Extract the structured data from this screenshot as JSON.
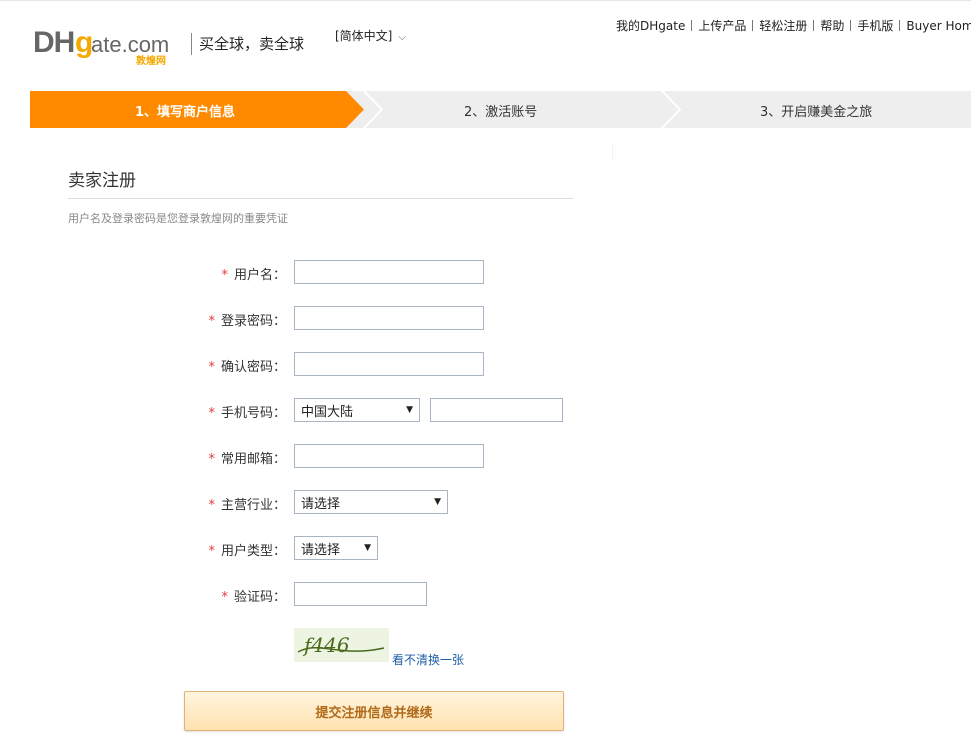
{
  "header": {
    "logo": {
      "brand": "DHgate.com",
      "sub": "敦煌网",
      "logo_colors": {
        "dh": "#666666",
        "gate": "#f5a800",
        "sub": "#f5a800"
      }
    },
    "slogan": "买全球，卖全球",
    "language": "[简体中文]",
    "links": [
      "我的DHgate",
      "上传产品",
      "轻松注册",
      "帮助",
      "手机版",
      "Buyer Home"
    ]
  },
  "steps": [
    {
      "label": "1、填写商户信息",
      "active": true
    },
    {
      "label": "2、激活账号",
      "active": false
    },
    {
      "label": "3、开启赚美金之旅",
      "active": false
    }
  ],
  "form": {
    "title": "卖家注册",
    "note": "用户名及登录密码是您登录敦煌网的重要凭证",
    "required_mark": "*",
    "fields": {
      "username": {
        "label": "用户名：",
        "value": ""
      },
      "password": {
        "label": "登录密码：",
        "value": ""
      },
      "confirm_password": {
        "label": "确认密码：",
        "value": ""
      },
      "phone": {
        "label": "手机号码：",
        "region": "中国大陆",
        "value": ""
      },
      "email": {
        "label": "常用邮箱：",
        "value": ""
      },
      "industry": {
        "label": "主营行业：",
        "selected": "请选择"
      },
      "user_type": {
        "label": "用户类型：",
        "selected": "请选择"
      },
      "captcha": {
        "label": "验证码：",
        "value": "",
        "image_text": "f446",
        "refresh_label": "看不清换一张"
      }
    },
    "submit_label": "提交注册信息并继续"
  },
  "colors": {
    "accent": "#ff8a00",
    "required": "#e4393c",
    "link": "#1f5fa6"
  }
}
